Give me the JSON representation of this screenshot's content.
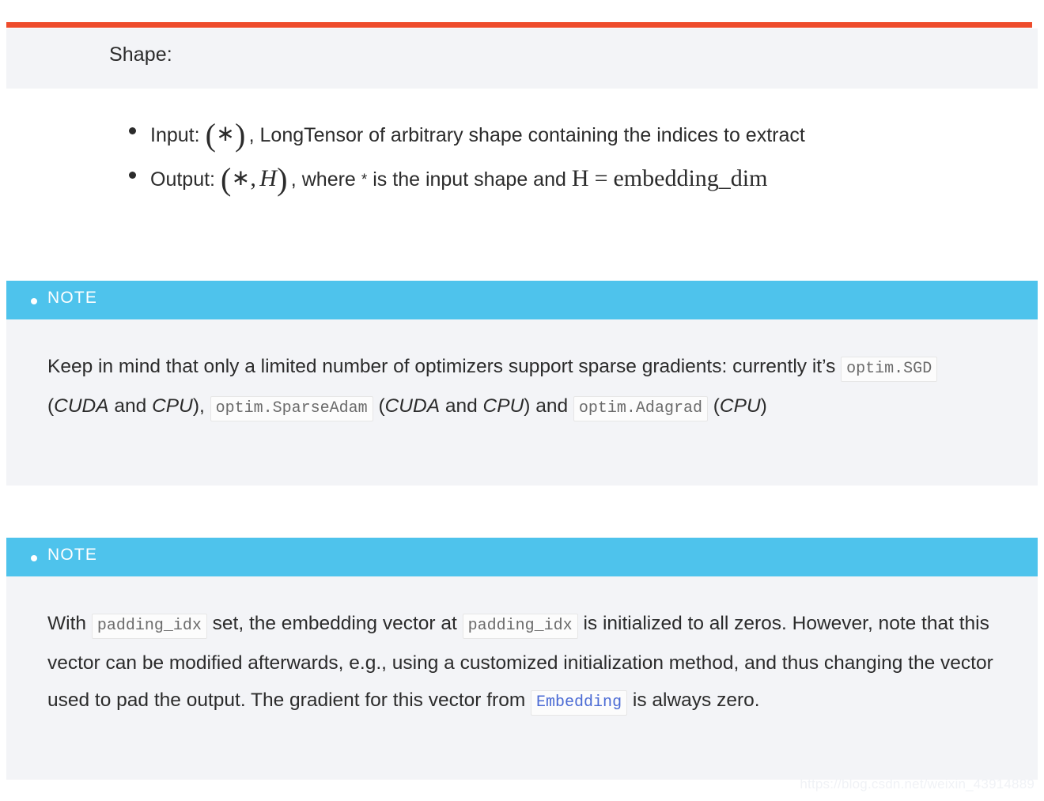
{
  "accent": {
    "orange_rule": "#ee4c2c",
    "note_header_bg": "#4ec3ec",
    "panel_bg": "#f3f4f7",
    "code_link": "#4a6ad4"
  },
  "shape_section": {
    "title": "Shape:",
    "items": [
      {
        "label": "Input:",
        "math": "(*)",
        "math_open": "(",
        "math_star": "∗",
        "math_close": ")",
        "comma": ",",
        "rest": "LongTensor of arbitrary shape containing the indices to extract"
      },
      {
        "label": "Output:",
        "math_open": "(",
        "math_star": "∗",
        "math_comma": ",",
        "math_var": "H",
        "math_close": ")",
        "comma": ",",
        "rest_a": "where",
        "star_inline": "*",
        "rest_b": "is the input shape and",
        "equation_lhs": "H",
        "equation_eq": "=",
        "equation_rhs": "embedding_dim"
      }
    ]
  },
  "notes": [
    {
      "label": "NOTE",
      "paragraph_parts": [
        {
          "type": "text",
          "value": "Keep in mind that only a limited number of optimizers support sparse gradients: currently it’s "
        },
        {
          "type": "code",
          "value": "optim.SGD"
        },
        {
          "type": "text",
          "value": " ("
        },
        {
          "type": "em",
          "value": "CUDA"
        },
        {
          "type": "text",
          "value": " and "
        },
        {
          "type": "em",
          "value": "CPU"
        },
        {
          "type": "text",
          "value": "), "
        },
        {
          "type": "code",
          "value": "optim.SparseAdam"
        },
        {
          "type": "text",
          "value": " ("
        },
        {
          "type": "em",
          "value": "CUDA"
        },
        {
          "type": "text",
          "value": " and "
        },
        {
          "type": "em",
          "value": "CPU"
        },
        {
          "type": "text",
          "value": ") and "
        },
        {
          "type": "code",
          "value": "optim.Adagrad"
        },
        {
          "type": "text",
          "value": " ("
        },
        {
          "type": "em",
          "value": "CPU"
        },
        {
          "type": "text",
          "value": ")"
        }
      ]
    },
    {
      "label": "NOTE",
      "paragraph_parts": [
        {
          "type": "text",
          "value": "With "
        },
        {
          "type": "code",
          "value": "padding_idx"
        },
        {
          "type": "text",
          "value": " set, the embedding vector at "
        },
        {
          "type": "code",
          "value": "padding_idx"
        },
        {
          "type": "text",
          "value": " is initialized to all zeros. However, note that this vector can be modified afterwards, e.g., using a customized initialization method, and thus changing the vector used to pad the output. The gradient for this vector from "
        },
        {
          "type": "code-link",
          "value": "Embedding"
        },
        {
          "type": "text",
          "value": " is always zero."
        }
      ]
    }
  ],
  "watermark": "https://blog.csdn.net/weixin_43914889"
}
